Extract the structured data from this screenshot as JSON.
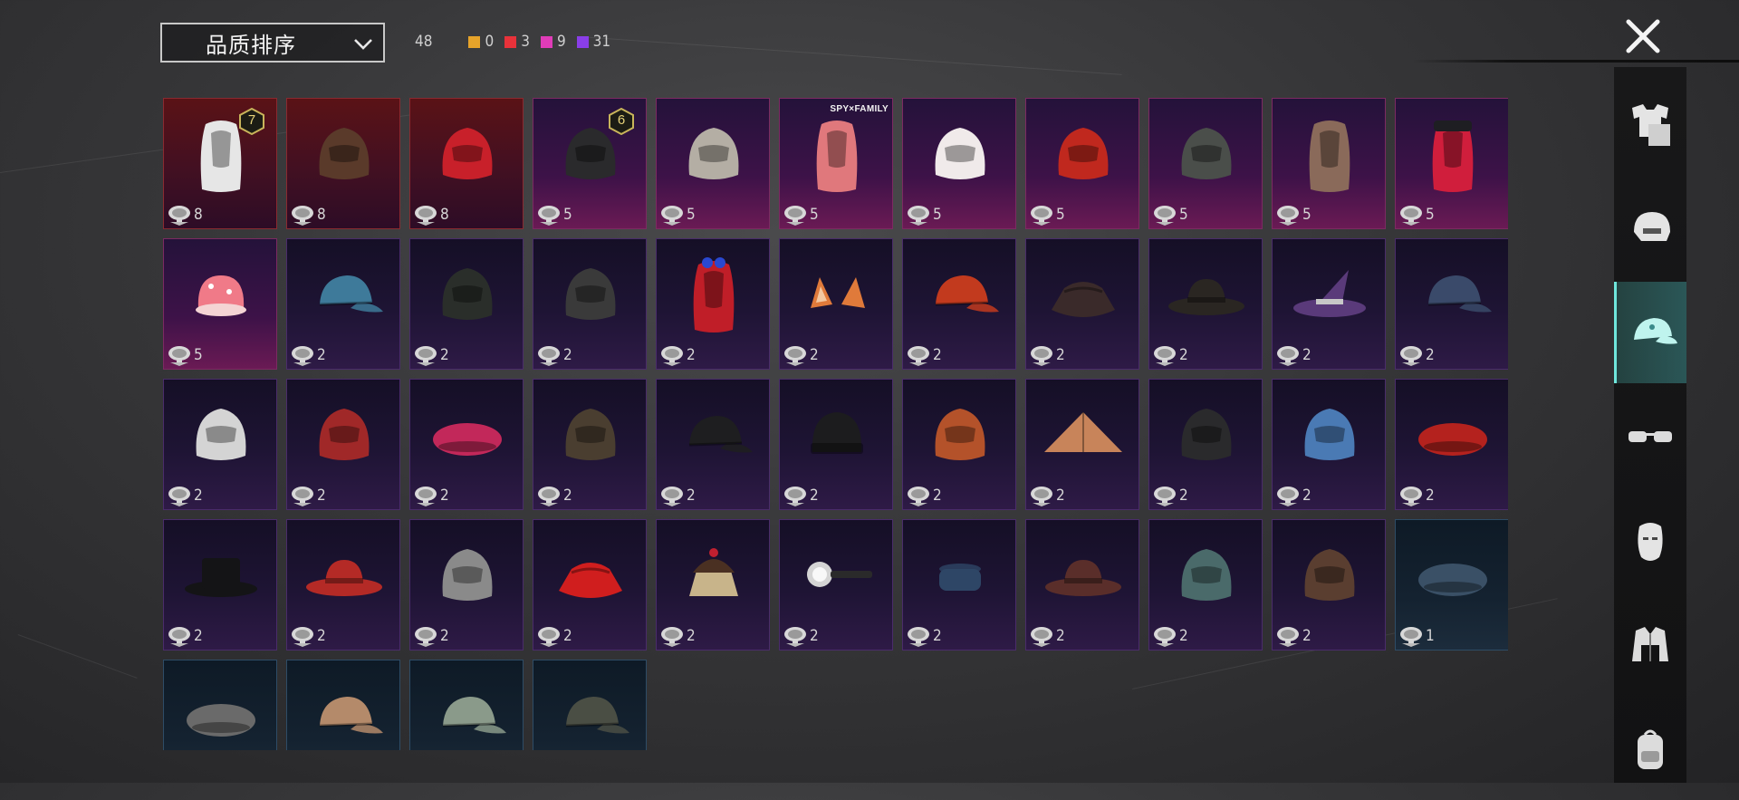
{
  "sort": {
    "label": "品质排序"
  },
  "counts": {
    "total": "48",
    "qualities": [
      {
        "color": "#e6a32a",
        "value": "0"
      },
      {
        "color": "#e8323a",
        "value": "3"
      },
      {
        "color": "#e03cb8",
        "value": "9"
      },
      {
        "color": "#8a3ee8",
        "value": "31"
      }
    ]
  },
  "items": [
    {
      "name": "white-hair",
      "quality": "red",
      "count": "8",
      "badge": "7",
      "icon": "long-hair-icon",
      "color": "#e6e6e6"
    },
    {
      "name": "brown-wolf-mask",
      "quality": "red",
      "count": "8",
      "icon": "animal-mask-icon",
      "color": "#5a3a2a"
    },
    {
      "name": "red-helmet",
      "quality": "red",
      "count": "8",
      "icon": "full-helmet-icon",
      "color": "#c8202a"
    },
    {
      "name": "horned-mask",
      "quality": "pink",
      "count": "5",
      "badge": "6",
      "icon": "horned-mask-icon",
      "color": "#2a2a2c"
    },
    {
      "name": "grey-hood",
      "quality": "pink",
      "count": "5",
      "icon": "hood-icon",
      "color": "#b4aea4"
    },
    {
      "name": "pink-bob-hair",
      "quality": "pink",
      "count": "5",
      "brand": "SPY×FAMILY",
      "icon": "bob-hair-icon",
      "color": "#e0787c"
    },
    {
      "name": "lion-dance-hat",
      "quality": "pink",
      "count": "5",
      "icon": "dragon-head-icon",
      "color": "#f0eaea"
    },
    {
      "name": "dragon-mask",
      "quality": "pink",
      "count": "5",
      "icon": "dragon-mask-icon",
      "color": "#c0281e"
    },
    {
      "name": "spiked-helmet",
      "quality": "pink",
      "count": "5",
      "icon": "spiked-helmet-icon",
      "color": "#4a4e4a"
    },
    {
      "name": "ponytail-hair",
      "quality": "pink",
      "count": "5",
      "icon": "ponytail-hair-icon",
      "color": "#8a6a5a"
    },
    {
      "name": "beret-red-hair",
      "quality": "pink",
      "count": "5",
      "icon": "cap-hair-icon",
      "color": "#d01e3c"
    },
    {
      "name": "strawberry-hat",
      "quality": "pink",
      "count": "5",
      "icon": "round-hat-icon",
      "color": "#f07a88"
    },
    {
      "name": "blue-cap",
      "quality": "purple",
      "count": "2",
      "icon": "baseball-cap-icon",
      "color": "#3e7a9a"
    },
    {
      "name": "gas-mask-helmet",
      "quality": "purple",
      "count": "2",
      "icon": "gas-mask-icon",
      "color": "#2a2e2a"
    },
    {
      "name": "visor-helmet",
      "quality": "purple",
      "count": "2",
      "icon": "visor-helmet-icon",
      "color": "#3a3a3a"
    },
    {
      "name": "bow-red-hair",
      "quality": "purple",
      "count": "2",
      "icon": "bow-hair-icon",
      "color": "#c01e28"
    },
    {
      "name": "cat-ears",
      "quality": "purple",
      "count": "2",
      "icon": "cat-ears-icon",
      "color": "#e07a3a"
    },
    {
      "name": "red-gold-cap",
      "quality": "purple",
      "count": "2",
      "icon": "baseball-cap-icon",
      "color": "#c23a1e"
    },
    {
      "name": "bucket-hat-hair",
      "quality": "purple",
      "count": "2",
      "icon": "bucket-hat-icon",
      "color": "#3a2a2a"
    },
    {
      "name": "black-fedora",
      "quality": "purple",
      "count": "2",
      "icon": "fedora-icon",
      "color": "#2a2622"
    },
    {
      "name": "witch-hat",
      "quality": "purple",
      "count": "2",
      "icon": "witch-hat-icon",
      "color": "#5a3a7a"
    },
    {
      "name": "navy-cap",
      "quality": "purple",
      "count": "2",
      "icon": "baseball-cap-icon",
      "color": "#3a4a6a"
    },
    {
      "name": "white-turban",
      "quality": "purple",
      "count": "2",
      "icon": "turban-icon",
      "color": "#d4d4d4"
    },
    {
      "name": "demon-mask",
      "quality": "purple",
      "count": "2",
      "icon": "demon-mask-icon",
      "color": "#a02828"
    },
    {
      "name": "pink-beret",
      "quality": "purple",
      "count": "2",
      "icon": "beret-icon",
      "color": "#c2285a"
    },
    {
      "name": "aviator-cap",
      "quality": "purple",
      "count": "2",
      "icon": "aviator-cap-icon",
      "color": "#4a3e30"
    },
    {
      "name": "black-cap",
      "quality": "purple",
      "count": "2",
      "icon": "baseball-cap-icon",
      "color": "#1e1e20"
    },
    {
      "name": "black-beanie",
      "quality": "purple",
      "count": "2",
      "icon": "beanie-icon",
      "color": "#1c1c1e"
    },
    {
      "name": "football-helmet",
      "quality": "purple",
      "count": "2",
      "icon": "football-helmet-icon",
      "color": "#b4522a"
    },
    {
      "name": "straw-conical-hat",
      "quality": "purple",
      "count": "2",
      "icon": "conical-hat-icon",
      "color": "#c8845a"
    },
    {
      "name": "black-mask-helmet",
      "quality": "purple",
      "count": "2",
      "icon": "full-helmet-icon",
      "color": "#2a2a2c"
    },
    {
      "name": "shark-hat",
      "quality": "purple",
      "count": "2",
      "icon": "shark-hat-icon",
      "color": "#4a7ab4"
    },
    {
      "name": "red-beret",
      "quality": "purple",
      "count": "2",
      "icon": "beret-icon",
      "color": "#b4221e"
    },
    {
      "name": "black-top-hat",
      "quality": "purple",
      "count": "2",
      "icon": "top-hat-icon",
      "color": "#141416"
    },
    {
      "name": "red-fedora",
      "quality": "purple",
      "count": "2",
      "icon": "fedora-icon",
      "color": "#b42a26"
    },
    {
      "name": "grey-shark-hat",
      "quality": "purple",
      "count": "2",
      "icon": "shark-hat-icon",
      "color": "#8a8a8a"
    },
    {
      "name": "red-bucket-hat",
      "quality": "purple",
      "count": "2",
      "icon": "bucket-hat-icon",
      "color": "#d01e1e"
    },
    {
      "name": "cupcake-hat",
      "quality": "purple",
      "count": "2",
      "icon": "cupcake-hat-icon",
      "color": "#c8b48a"
    },
    {
      "name": "headlamp",
      "quality": "purple",
      "count": "2",
      "icon": "headlamp-icon",
      "color": "#d4d4d4"
    },
    {
      "name": "navy-pillbox-hat",
      "quality": "purple",
      "count": "2",
      "icon": "pillbox-hat-icon",
      "color": "#2e4666"
    },
    {
      "name": "brown-fedora",
      "quality": "purple",
      "count": "2",
      "icon": "fedora-icon",
      "color": "#5a2e2a"
    },
    {
      "name": "mesh-helmet",
      "quality": "purple",
      "count": "2",
      "icon": "mesh-helmet-icon",
      "color": "#4a6a6a"
    },
    {
      "name": "goggle-aviator-cap",
      "quality": "purple",
      "count": "2",
      "icon": "aviator-cap-icon",
      "color": "#5a3e30"
    },
    {
      "name": "blue-beret",
      "quality": "blue",
      "count": "1",
      "icon": "beret-icon",
      "color": "#3a5066"
    },
    {
      "name": "grey-beret",
      "quality": "blue",
      "count": "",
      "icon": "beret-icon",
      "color": "#6a6a6a"
    },
    {
      "name": "tan-cap",
      "quality": "blue",
      "count": "",
      "icon": "baseball-cap-icon",
      "color": "#b48a6a"
    },
    {
      "name": "tan-blue-cap",
      "quality": "blue",
      "count": "",
      "icon": "baseball-cap-icon",
      "color": "#8a9a8a"
    },
    {
      "name": "camo-cap",
      "quality": "blue",
      "count": "",
      "icon": "baseball-cap-icon",
      "color": "#4a4e44"
    }
  ],
  "sidebar": [
    {
      "name": "outfit",
      "icon": "outfit-icon",
      "active": false
    },
    {
      "name": "head",
      "icon": "head-icon",
      "active": false
    },
    {
      "name": "hat",
      "icon": "cap-icon",
      "active": true
    },
    {
      "name": "glasses",
      "icon": "glasses-icon",
      "active": false
    },
    {
      "name": "face",
      "icon": "face-icon",
      "active": false
    },
    {
      "name": "jacket",
      "icon": "jacket-icon",
      "active": false
    },
    {
      "name": "backpack",
      "icon": "backpack-icon",
      "active": false
    }
  ]
}
